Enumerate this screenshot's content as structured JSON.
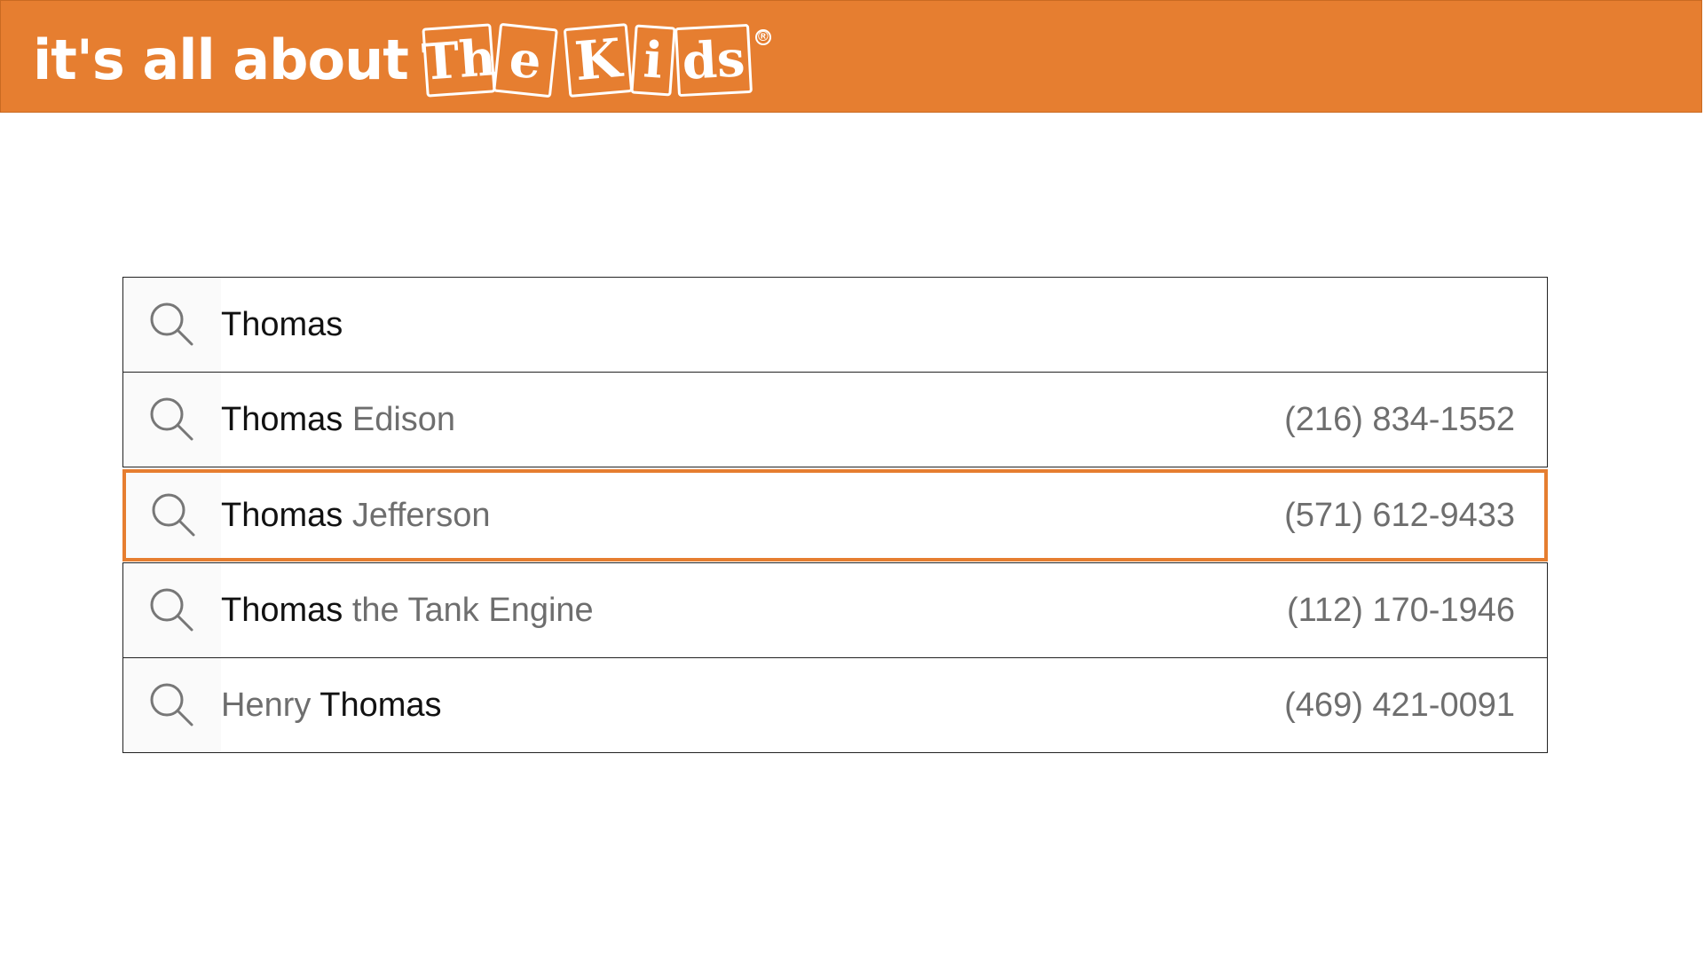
{
  "brand": {
    "tagline": "it's all about",
    "tiles": [
      "Th",
      "e",
      "K",
      "i",
      "ds"
    ],
    "registered": "®",
    "color": "#e67e30"
  },
  "search": {
    "query": "Thomas",
    "icon": "search-icon",
    "selected_index": 1,
    "results": [
      {
        "first": "Thomas",
        "middle": " ",
        "last": "Edison",
        "match_first": true,
        "phone": "(216) 834-1552"
      },
      {
        "first": "Thomas",
        "middle": " ",
        "last": "Jefferson",
        "match_first": true,
        "phone": "(571) 612-9433"
      },
      {
        "first": "Thomas",
        "middle": " ",
        "last": "the Tank Engine",
        "match_first": true,
        "phone": "(112) 170-1946"
      },
      {
        "first": "Henry",
        "middle": " ",
        "last": "Thomas",
        "match_first": false,
        "phone": "(469) 421-0091"
      }
    ]
  }
}
